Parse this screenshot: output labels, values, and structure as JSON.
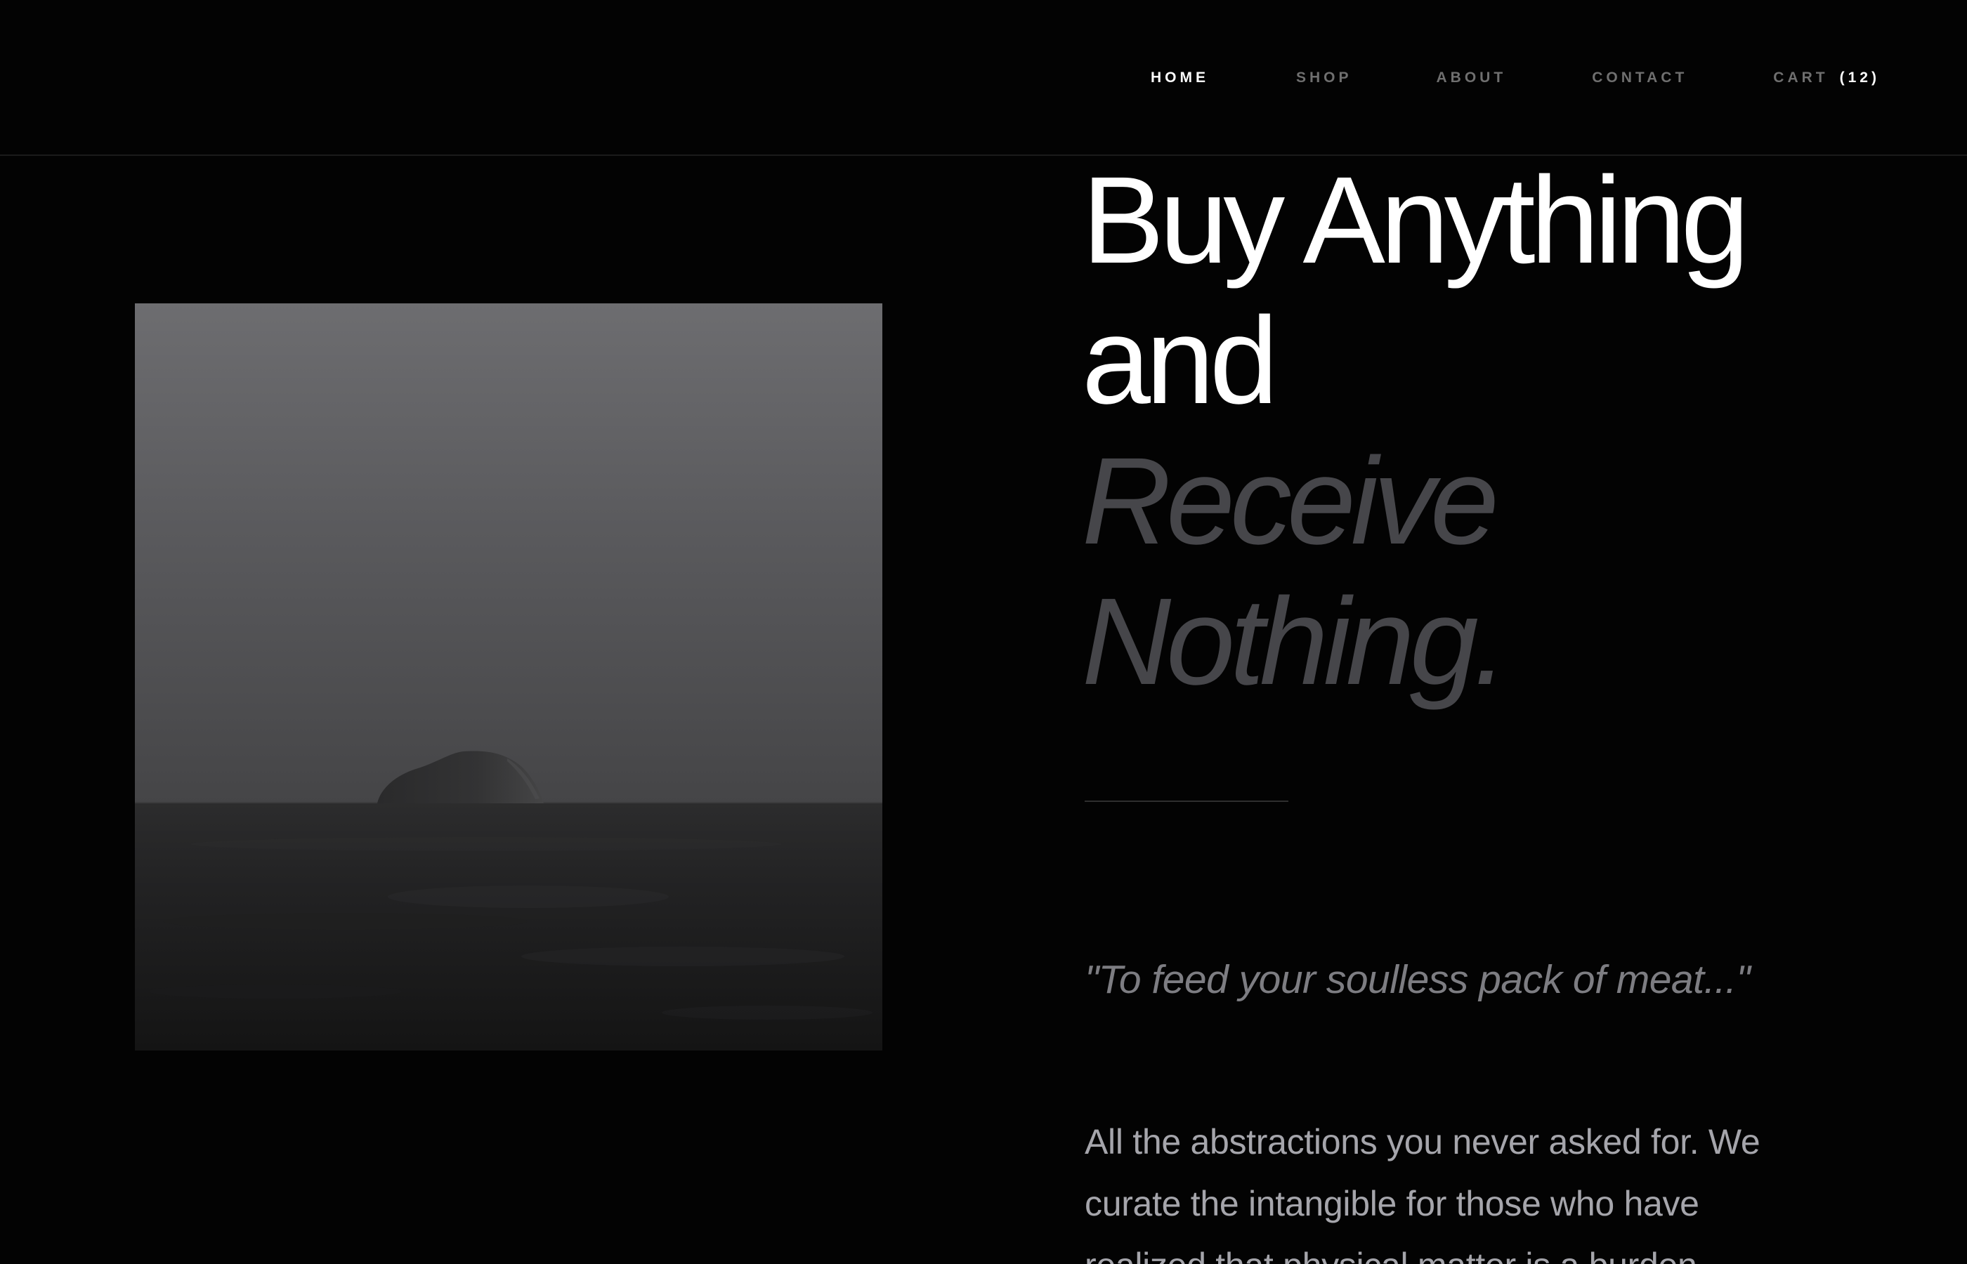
{
  "nav": {
    "items": [
      {
        "label": "HOME",
        "active": true
      },
      {
        "label": "SHOP",
        "active": false
      },
      {
        "label": "ABOUT",
        "active": false
      },
      {
        "label": "CONTACT",
        "active": false
      }
    ],
    "cart": {
      "label": "CART",
      "count": "(12)"
    }
  },
  "hero": {
    "headline": {
      "line1": "Buy Anything",
      "line2": "and",
      "line3": "Receive",
      "line4": "Nothing."
    },
    "quote": "\"To feed your soulless pack of meat...\"",
    "description": {
      "line1": "All the abstractions you never asked for. We",
      "line2": "curate the intangible for those who have",
      "line3": "realized that physical matter is a burden."
    }
  },
  "colors": {
    "background": "#030303",
    "text_primary": "#ffffff",
    "text_dim": "#46464a",
    "nav_inactive": "#6f6f6f",
    "quote": "#7d7d82",
    "body": "#a5a5ab"
  }
}
